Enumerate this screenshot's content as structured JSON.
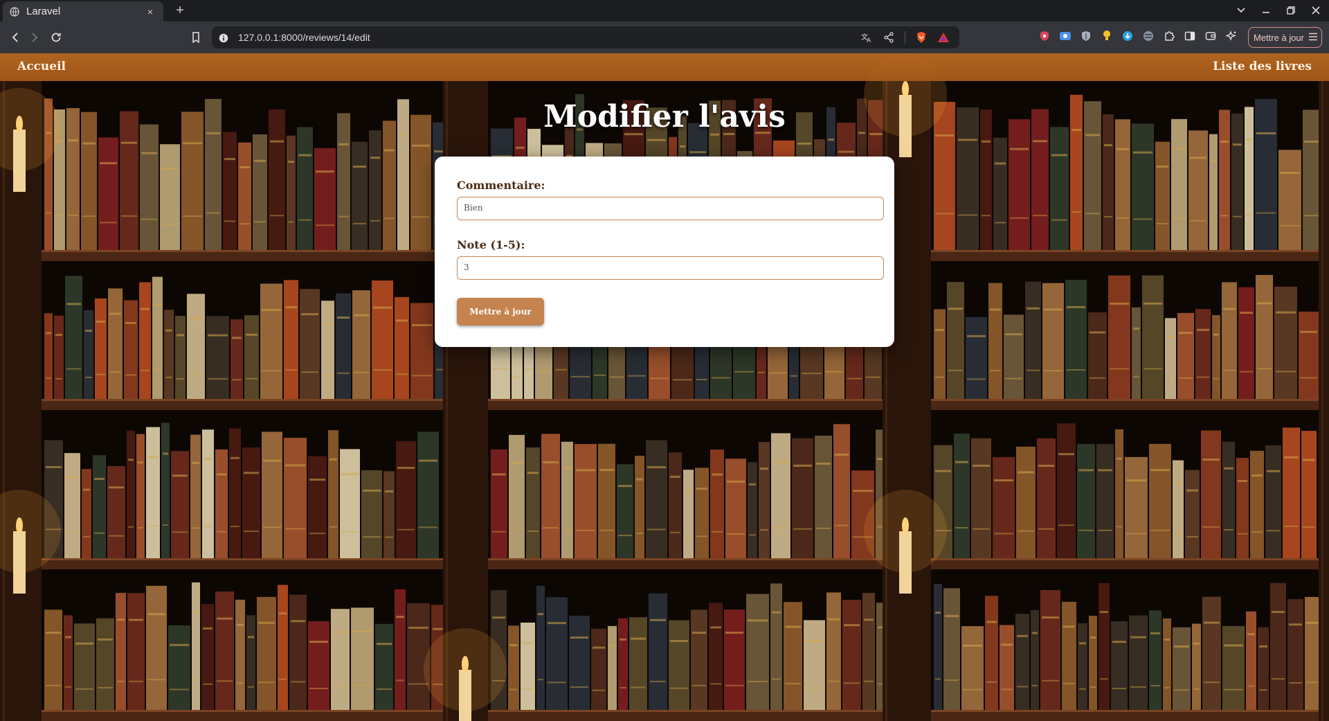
{
  "browser": {
    "tab_title": "Laravel",
    "tab_close": "×",
    "new_tab": "+",
    "url": "127.0.0.1:8000/reviews/14/edit",
    "update_button_label": "Mettre à jour",
    "update_button_icon": "menu-icon"
  },
  "site_nav": {
    "home_label": "Accueil",
    "books_label": "Liste des livres"
  },
  "page": {
    "title": "Modifier l'avis"
  },
  "form": {
    "comment_label": "Commentaire:",
    "comment_value": "Bien",
    "rating_label": "Note (1-5):",
    "rating_value": "3",
    "submit_label": "Mettre à jour"
  },
  "colors": {
    "nav_bar": "#b5631c",
    "button": "#c4834f",
    "input_border": "#c48654",
    "label_text": "#4a2c14"
  }
}
